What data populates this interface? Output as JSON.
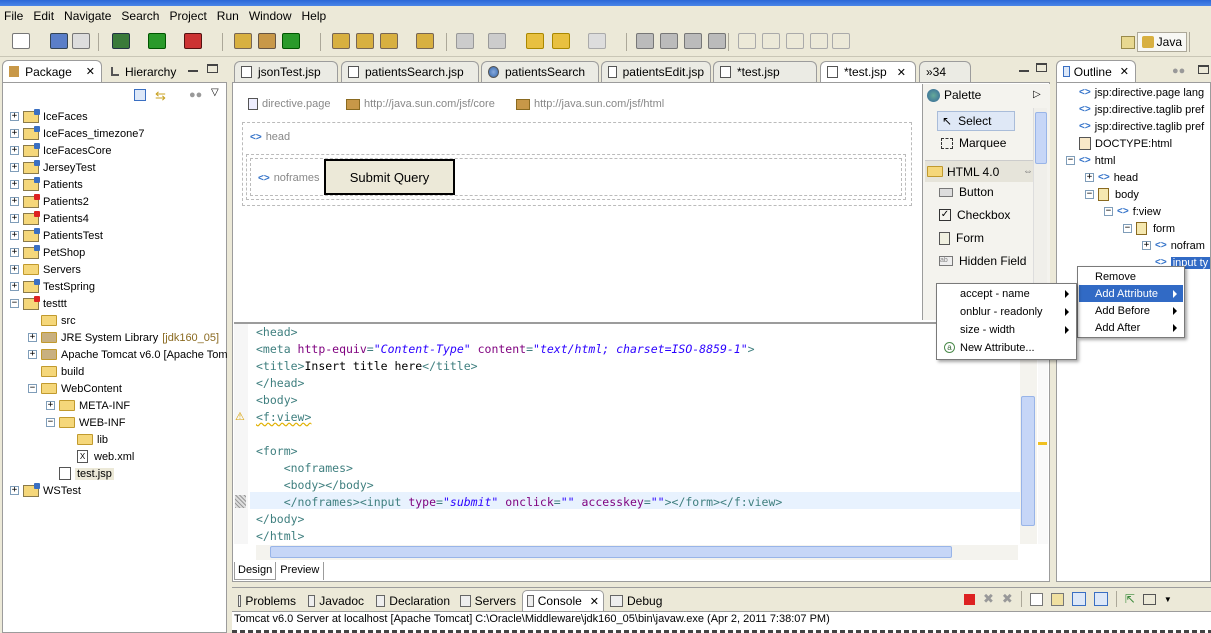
{
  "menu": [
    "File",
    "Edit",
    "Navigate",
    "Search",
    "Project",
    "Run",
    "Window",
    "Help"
  ],
  "perspective": {
    "label": "Java"
  },
  "left_tabs": [
    {
      "label": "Package"
    },
    {
      "label": "Hierarchy"
    }
  ],
  "package_tree": [
    {
      "label": "IceFaces",
      "indent": 0,
      "type": "project",
      "exp": "+"
    },
    {
      "label": "IceFaces_timezone7",
      "indent": 0,
      "type": "project",
      "exp": "+"
    },
    {
      "label": "IceFacesCore",
      "indent": 0,
      "type": "project",
      "exp": "+"
    },
    {
      "label": "JerseyTest",
      "indent": 0,
      "type": "project",
      "exp": "+"
    },
    {
      "label": "Patients",
      "indent": 0,
      "type": "project",
      "exp": "+"
    },
    {
      "label": "Patients2",
      "indent": 0,
      "type": "project-err",
      "exp": "+"
    },
    {
      "label": "Patients4",
      "indent": 0,
      "type": "project-err",
      "exp": "+"
    },
    {
      "label": "PatientsTest",
      "indent": 0,
      "type": "project",
      "exp": "+"
    },
    {
      "label": "PetShop",
      "indent": 0,
      "type": "project",
      "exp": "+"
    },
    {
      "label": "Servers",
      "indent": 0,
      "type": "folder",
      "exp": "+"
    },
    {
      "label": "TestSpring",
      "indent": 0,
      "type": "project",
      "exp": "+"
    },
    {
      "label": "testtt",
      "indent": 0,
      "type": "project-err",
      "exp": "-"
    },
    {
      "label": "src",
      "indent": 1,
      "type": "folder",
      "exp": ""
    },
    {
      "label": "JRE System Library",
      "extra": "[jdk160_05]",
      "indent": 1,
      "type": "lib",
      "exp": "+"
    },
    {
      "label": "Apache Tomcat v6.0 [Apache Tom",
      "indent": 1,
      "type": "lib",
      "exp": "+"
    },
    {
      "label": "build",
      "indent": 1,
      "type": "folder",
      "exp": ""
    },
    {
      "label": "WebContent",
      "indent": 1,
      "type": "folder",
      "exp": "-"
    },
    {
      "label": "META-INF",
      "indent": 2,
      "type": "folder",
      "exp": "+"
    },
    {
      "label": "WEB-INF",
      "indent": 2,
      "type": "folder",
      "exp": "-"
    },
    {
      "label": "lib",
      "indent": 3,
      "type": "folder",
      "exp": ""
    },
    {
      "label": "web.xml",
      "indent": 3,
      "type": "file",
      "exp": ""
    },
    {
      "label": "test.jsp",
      "indent": 2,
      "type": "jsp",
      "exp": "",
      "selected": true
    },
    {
      "label": "WSTest",
      "indent": 0,
      "type": "project",
      "exp": "+"
    }
  ],
  "editor_tabs": [
    {
      "label": "jsonTest.jsp"
    },
    {
      "label": "patientsSearch.jsp"
    },
    {
      "label": "patientsSearch"
    },
    {
      "label": "patientsEdit.jsp"
    },
    {
      "label": "*test.jsp"
    },
    {
      "label": "*test.jsp",
      "active": true
    },
    {
      "label": "»34"
    }
  ],
  "design": {
    "directive": "directive.page",
    "taglib1": "http://java.sun.com/jsf/core",
    "taglib2": "http://java.sun.com/jsf/html",
    "head": "head",
    "noframes": "noframes",
    "submit": "Submit Query"
  },
  "palette": {
    "title": "Palette",
    "select": "Select",
    "marquee": "Marquee",
    "group": "HTML 4.0",
    "items": [
      "Button",
      "Checkbox",
      "Form",
      "Hidden Field"
    ]
  },
  "code_lines": [
    [
      [
        "tag",
        "<head>"
      ]
    ],
    [
      [
        "tag",
        "<meta "
      ],
      [
        "attr",
        "http-equiv"
      ],
      [
        "tag",
        "="
      ],
      [
        "val",
        "\"Content-Type\""
      ],
      [
        "tag",
        " "
      ],
      [
        "attr",
        "content"
      ],
      [
        "tag",
        "="
      ],
      [
        "val",
        "\"text/html; charset=ISO-8859-1\""
      ],
      [
        "tag",
        ">"
      ]
    ],
    [
      [
        "tag",
        "<title>"
      ],
      [
        "txt",
        "Insert title here"
      ],
      [
        "tag",
        "</title>"
      ]
    ],
    [
      [
        "tag",
        "</head>"
      ]
    ],
    [
      [
        "tag",
        "<body>"
      ]
    ],
    [
      [
        "tag",
        "<f:view>"
      ]
    ],
    [
      [
        "txt",
        ""
      ]
    ],
    [
      [
        "tag",
        "<form>"
      ]
    ],
    [
      [
        "tag",
        "    <noframes>"
      ]
    ],
    [
      [
        "tag",
        "    <body></body>"
      ]
    ],
    [
      [
        "tag",
        "    </noframes><input "
      ],
      [
        "attr",
        "type"
      ],
      [
        "tag",
        "="
      ],
      [
        "val",
        "\"submit\""
      ],
      [
        "tag",
        " "
      ],
      [
        "attr",
        "onclick"
      ],
      [
        "tag",
        "="
      ],
      [
        "val",
        "\"\""
      ],
      [
        "tag",
        " "
      ],
      [
        "attr",
        "accesskey"
      ],
      [
        "tag",
        "="
      ],
      [
        "val",
        "\"\""
      ],
      [
        "tag",
        "></form></f:view>"
      ]
    ],
    [
      [
        "tag",
        "</body>"
      ]
    ],
    [
      [
        "tag",
        "</html>"
      ]
    ]
  ],
  "bottom_editor_tabs": [
    "Design",
    "Preview"
  ],
  "outline": {
    "title": "Outline",
    "rows": [
      {
        "label": "jsp:directive.page lang",
        "indent": 0,
        "type": "angle"
      },
      {
        "label": "jsp:directive.taglib pref",
        "indent": 0,
        "type": "angle"
      },
      {
        "label": "jsp:directive.taglib pref",
        "indent": 0,
        "type": "angle"
      },
      {
        "label": "DOCTYPE:html",
        "indent": 0,
        "type": "doc"
      },
      {
        "label": "html",
        "indent": 0,
        "type": "angle",
        "exp": "-"
      },
      {
        "label": "head",
        "indent": 1,
        "type": "angle",
        "exp": "+"
      },
      {
        "label": "body",
        "indent": 1,
        "type": "page",
        "exp": "-"
      },
      {
        "label": "f:view",
        "indent": 2,
        "type": "angle",
        "exp": "-"
      },
      {
        "label": "form",
        "indent": 3,
        "type": "page",
        "exp": "-"
      },
      {
        "label": "nofram",
        "indent": 4,
        "type": "angle",
        "exp": "+"
      },
      {
        "label": "input ty",
        "indent": 4,
        "type": "angle",
        "selected": true
      }
    ]
  },
  "context_menu": [
    "Remove",
    "Add Attribute",
    "Add Before",
    "Add After"
  ],
  "submenu": [
    "accept - name",
    "onblur - readonly",
    "size - width",
    "New Attribute..."
  ],
  "bottom_tabs": [
    "Problems",
    "Javadoc",
    "Declaration",
    "Servers",
    "Console",
    "Debug"
  ],
  "console_status": "Tomcat v6.0 Server at localhost [Apache Tomcat] C:\\Oracle\\Middleware\\jdk160_05\\bin\\javaw.exe (Apr 2, 2011 7:38:07 PM)"
}
